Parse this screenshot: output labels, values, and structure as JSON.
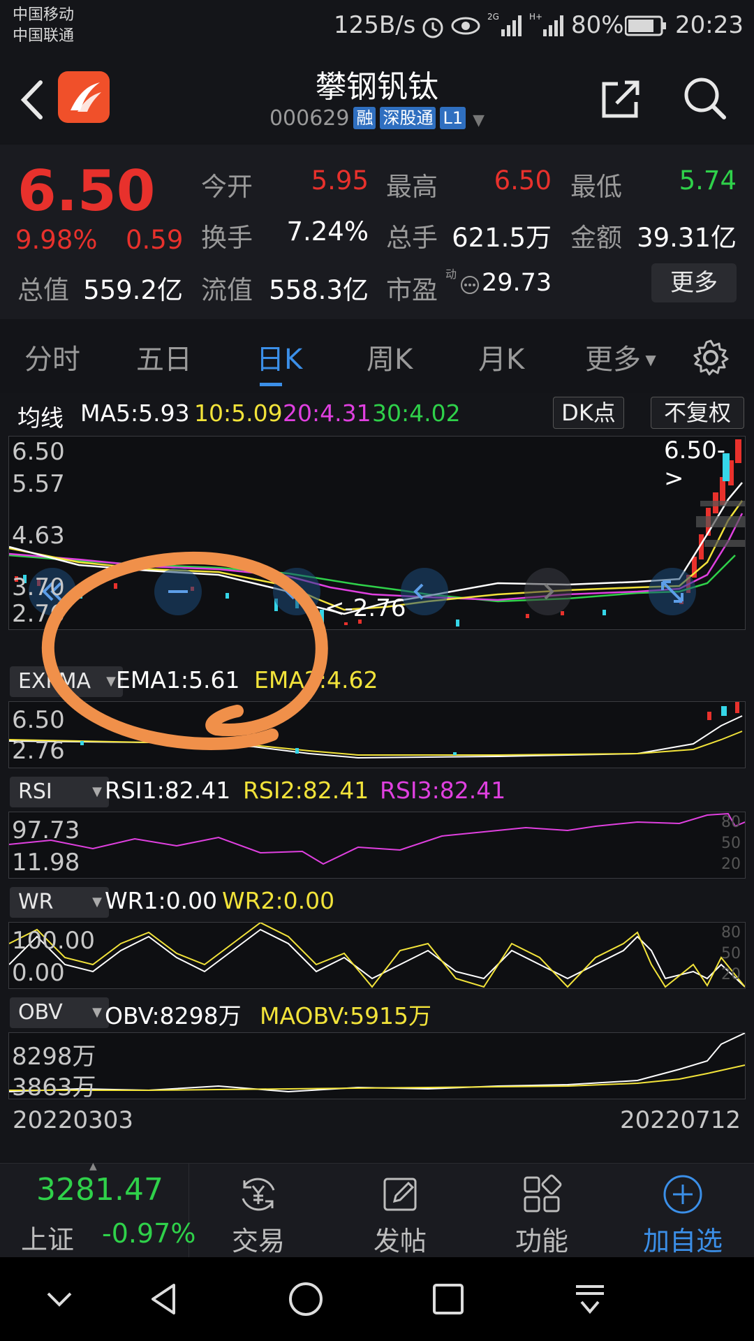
{
  "status": {
    "carrier1": "中国移动",
    "carrier2": "中国联通",
    "speed": "125B/s",
    "battery": "80%",
    "time": "20:23"
  },
  "header": {
    "title": "攀钢钒钛",
    "code": "000629",
    "tags": [
      "融",
      "深股通",
      "L1"
    ]
  },
  "quote": {
    "price": "6.50",
    "change_pct": "9.98%",
    "change_amt": "0.59",
    "rows": [
      [
        {
          "label": "今开",
          "value": "5.95"
        },
        {
          "label": "最高",
          "value": "6.50"
        },
        {
          "label": "最低",
          "value": "5.74"
        }
      ],
      [
        {
          "label": "换手",
          "value": "7.24%"
        },
        {
          "label": "总手",
          "value": "621.5万"
        },
        {
          "label": "金额",
          "value": "39.31亿"
        }
      ]
    ],
    "total_value_label": "总值",
    "total_value": "559.2亿",
    "float_value_label": "流值",
    "float_value": "558.3亿",
    "pe_label": "市盈",
    "pe_sup": "动",
    "pe_value": "29.73",
    "more_button": "更多"
  },
  "tabs": [
    "分时",
    "五日",
    "日K",
    "周K",
    "月K",
    "更多"
  ],
  "active_tab": "日K",
  "ma": {
    "label": "均线",
    "ma5": "MA5:5.93",
    "ma10": "10:5.09",
    "ma20": "20:4.31",
    "ma30": "30:4.02",
    "dk_button": "DK点",
    "fq_button": "不复权"
  },
  "kline": {
    "y_labels": [
      "6.50",
      "5.57",
      "4.63",
      "3.70",
      "2.76"
    ],
    "max_marker": "6.50->",
    "min_marker": "<-2.76"
  },
  "ema": {
    "selector": "EXPMA",
    "ema1": "EMA1:5.61",
    "ema2": "EMA2:4.62",
    "y_labels": [
      "6.50",
      "2.76"
    ]
  },
  "rsi": {
    "selector": "RSI",
    "rsi1": "RSI1:82.41",
    "rsi2": "RSI2:82.41",
    "rsi3": "RSI3:82.41",
    "y_labels": [
      "97.73",
      "11.98"
    ],
    "right_ticks": [
      "80",
      "50",
      "20"
    ]
  },
  "wr": {
    "selector": "WR",
    "wr1": "WR1:0.00",
    "wr2": "WR2:0.00",
    "y_labels": [
      "100.00",
      "0.00"
    ],
    "right_ticks": [
      "80",
      "50",
      "20"
    ]
  },
  "obv": {
    "selector": "OBV",
    "obv": "OBV:8298万",
    "maobv": "MAOBV:5915万",
    "y_labels": [
      "8298万",
      "3863万"
    ]
  },
  "dates": {
    "start": "20220303",
    "end": "20220712"
  },
  "bottom_bar": {
    "index_value": "3281.47",
    "index_name": "上证",
    "index_change": "-0.97%",
    "items": [
      "交易",
      "发帖",
      "功能",
      "加自选"
    ]
  },
  "colors": {
    "up": "#e8312c",
    "down": "#2fd14a",
    "accent": "#3b8fe8",
    "ma10": "#f2e33a",
    "ma20": "#e040e0",
    "ma30": "#2fd14a",
    "annotation": "#f0904a"
  }
}
